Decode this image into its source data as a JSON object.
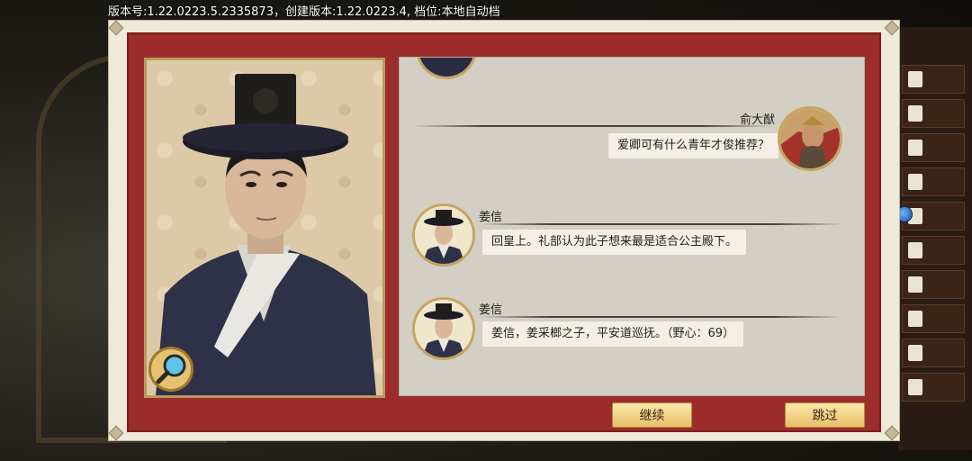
{
  "version_bar": "版本号:1.22.0223.5.2335873，创建版本:1.22.0223.4, 档位:本地自动档",
  "speaker_portrait": {
    "name": "姜信",
    "magnify_icon": "magnifier-icon"
  },
  "chat": {
    "messages": [
      {
        "speaker": "俞大猷",
        "text": "爱卿可有什么青年才俊推荐？",
        "side": "right"
      },
      {
        "speaker": "姜信",
        "text": "回皇上。礼部认为此子想来最是适合公主殿下。",
        "side": "left"
      },
      {
        "speaker": "姜信",
        "text": "姜信，姜采榔之子，平安道巡抚。（野心：69）",
        "side": "left"
      }
    ]
  },
  "buttons": {
    "continue": "继续",
    "skip": "跳过"
  },
  "colors": {
    "panel_red": "#9c2d2c",
    "frame": "#efe9da",
    "chat_bg": "#d4cfc4",
    "button_gold": "#e8c06a"
  }
}
